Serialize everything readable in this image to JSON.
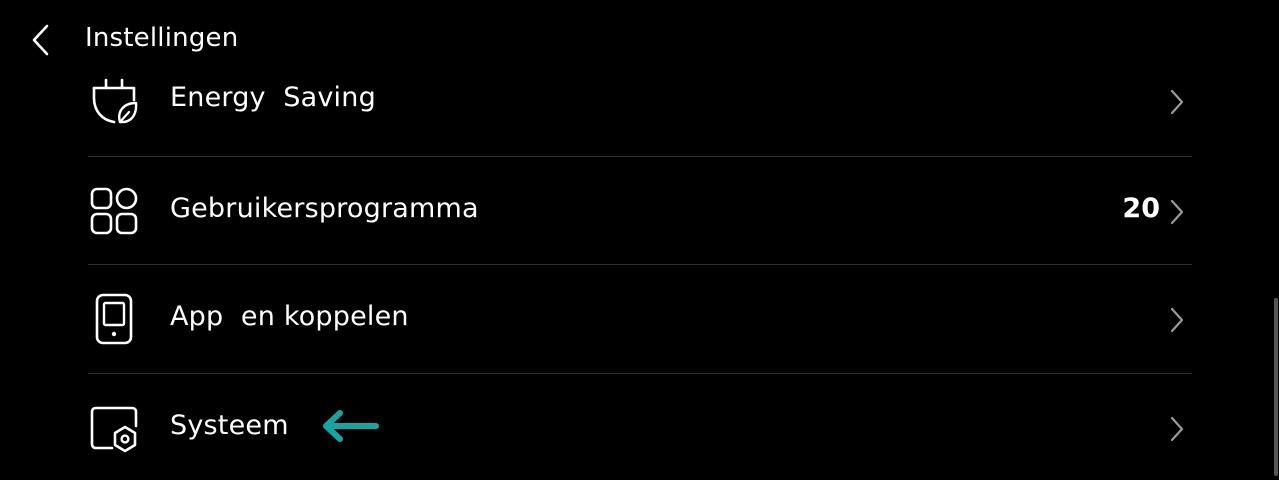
{
  "header": {
    "title": "Instellingen"
  },
  "items": [
    {
      "label": "Energy  Saving",
      "icon": "energy-saving-plug-leaf-icon",
      "value": ""
    },
    {
      "label": "Gebruikersprogramma",
      "icon": "grid-apps-icon",
      "value": "20"
    },
    {
      "label": "App  en koppelen",
      "icon": "tablet-device-icon",
      "value": ""
    },
    {
      "label": "Systeem",
      "icon": "system-gear-window-icon",
      "value": ""
    }
  ],
  "annotation": {
    "color": "#16a5a0",
    "icon": "arrow-left-icon"
  },
  "colors": {
    "background": "#000000",
    "text": "#ffffff",
    "divider": "#2f2f2f",
    "chevron": "#9a9a9a"
  }
}
